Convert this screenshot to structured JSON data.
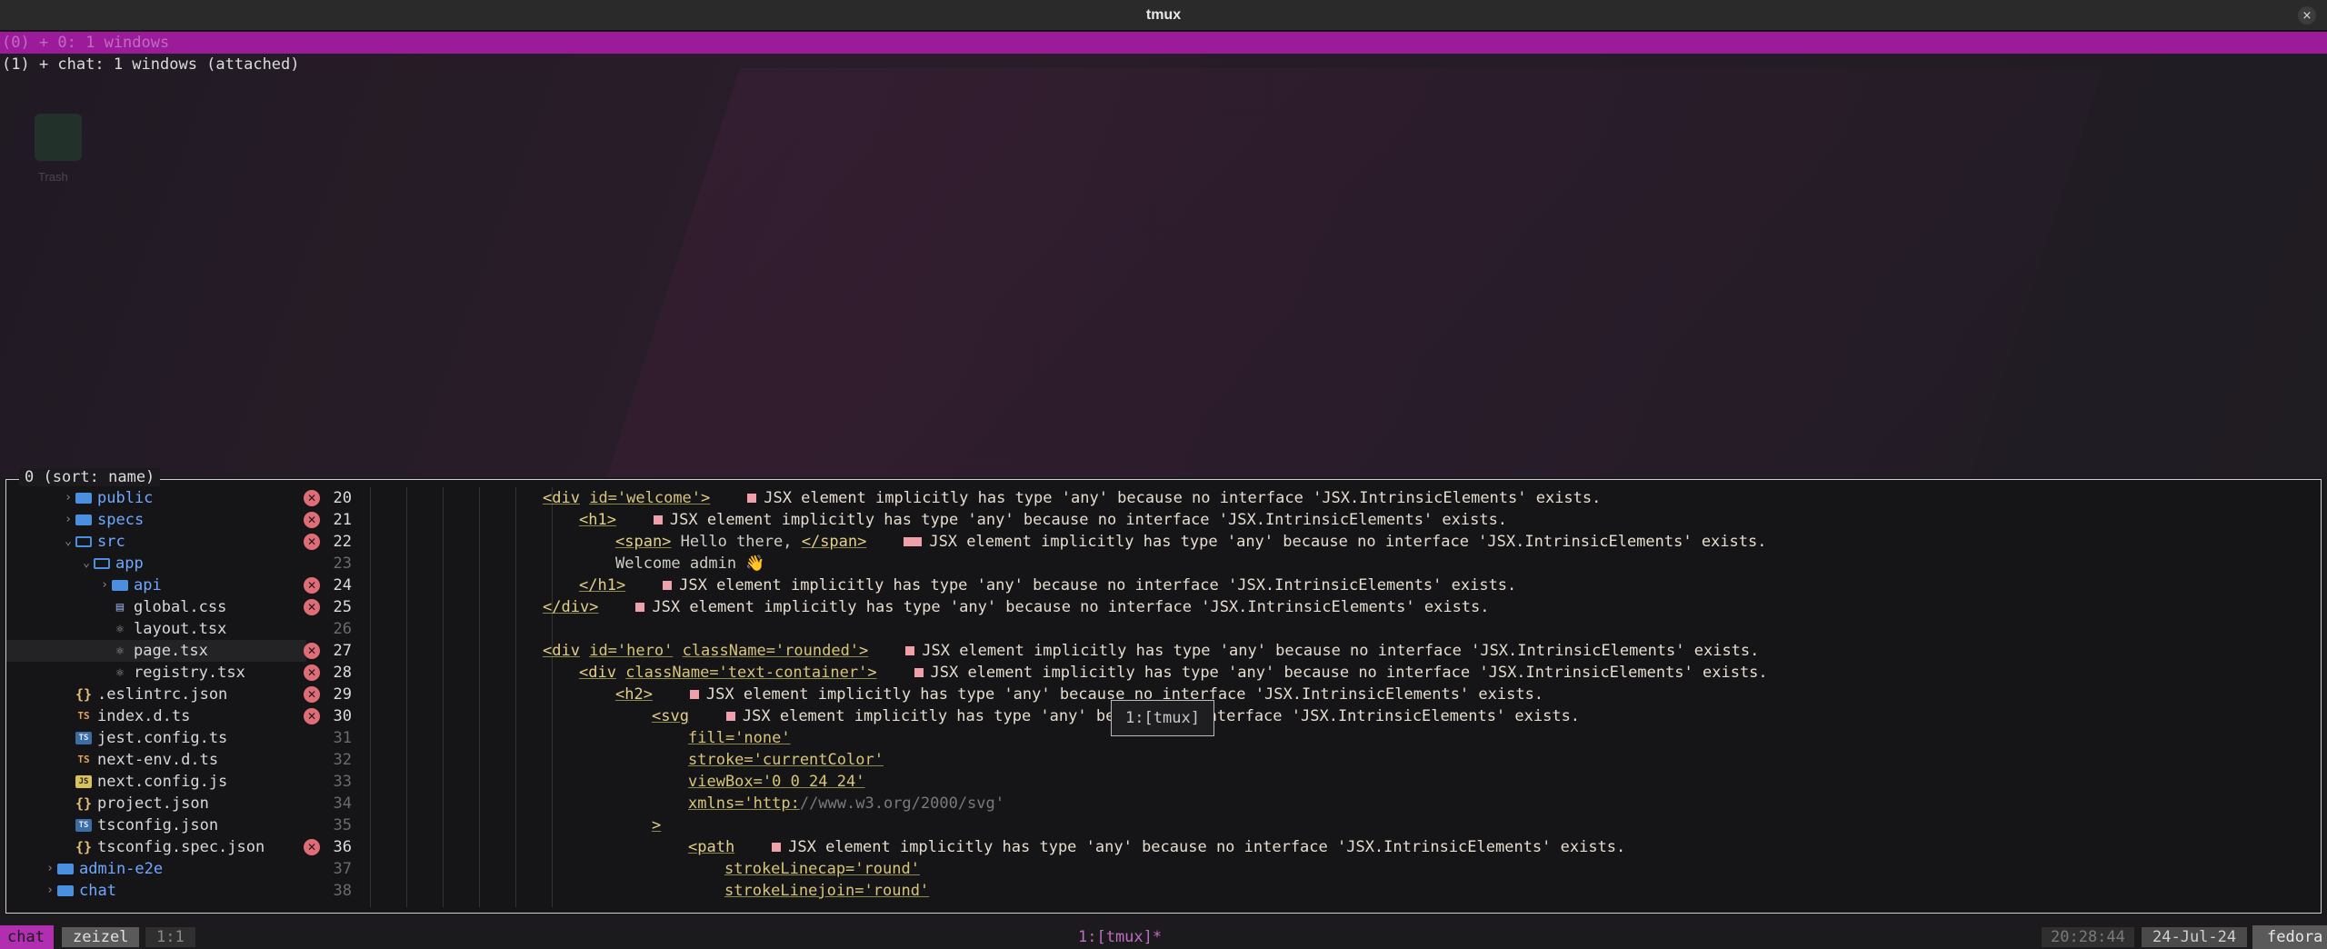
{
  "window": {
    "title": "tmux",
    "close_glyph": "×"
  },
  "tree": {
    "sessions": [
      {
        "text": "(0) + 0: 1 windows",
        "selected": true
      },
      {
        "text": "(1) + chat: 1 windows (attached)",
        "selected": false
      }
    ]
  },
  "desktop": {
    "trash_label": "Trash"
  },
  "preview": {
    "label": "0 (sort: name)",
    "explorer": [
      {
        "name": "public",
        "icon": "folder-icon",
        "depth": 2,
        "chevron": "›",
        "badge": "✕",
        "line": "20"
      },
      {
        "name": "specs",
        "icon": "folder-icon",
        "depth": 2,
        "chevron": "›",
        "badge": "✕",
        "line": "21"
      },
      {
        "name": "src",
        "icon": "folder-open-icon",
        "depth": 2,
        "chevron": "⌄",
        "badge": "✕",
        "line": "22"
      },
      {
        "name": "app",
        "icon": "folder-open-icon",
        "depth": 3,
        "chevron": "⌄",
        "badge": "",
        "line": "23"
      },
      {
        "name": "api",
        "icon": "folder-icon",
        "depth": 4,
        "chevron": "›",
        "badge": "✕",
        "line": "24"
      },
      {
        "name": "global.css",
        "icon": "css-file-icon",
        "depth": 4,
        "chevron": "",
        "badge": "✕",
        "line": "25"
      },
      {
        "name": "layout.tsx",
        "icon": "react-file-icon",
        "depth": 4,
        "chevron": "",
        "badge": "",
        "line": "26"
      },
      {
        "name": "page.tsx",
        "icon": "react-file-icon",
        "depth": 4,
        "chevron": "",
        "badge": "✕",
        "line": "27",
        "selected": true
      },
      {
        "name": "registry.tsx",
        "icon": "react-file-icon",
        "depth": 4,
        "chevron": "",
        "badge": "✕",
        "line": "28"
      },
      {
        "name": ".eslintrc.json",
        "icon": "json-file-icon",
        "depth": 2,
        "chevron": "",
        "badge": "✕",
        "line": "29"
      },
      {
        "name": "index.d.ts",
        "icon": "ts-file-icon",
        "depth": 2,
        "chevron": "",
        "badge": "✕",
        "line": "30"
      },
      {
        "name": "jest.config.ts",
        "icon": "tsconfig-file-icon",
        "depth": 2,
        "chevron": "",
        "badge": "",
        "line": "31"
      },
      {
        "name": "next-env.d.ts",
        "icon": "ts-file-icon",
        "depth": 2,
        "chevron": "",
        "badge": "",
        "line": "32"
      },
      {
        "name": "next.config.js",
        "icon": "js-file-icon",
        "depth": 2,
        "chevron": "",
        "badge": "",
        "line": "33"
      },
      {
        "name": "project.json",
        "icon": "json-file-icon",
        "depth": 2,
        "chevron": "",
        "badge": "",
        "line": "34"
      },
      {
        "name": "tsconfig.json",
        "icon": "tsconfig-file-icon",
        "depth": 2,
        "chevron": "",
        "badge": "",
        "line": "35"
      },
      {
        "name": "tsconfig.spec.json",
        "icon": "json-file-icon",
        "depth": 2,
        "chevron": "",
        "badge": "✕",
        "line": "36"
      },
      {
        "name": "admin-e2e",
        "icon": "folder-icon",
        "depth": 1,
        "chevron": "›",
        "badge": "",
        "line": "37"
      },
      {
        "name": "chat",
        "icon": "folder-icon",
        "depth": 1,
        "chevron": "›",
        "badge": "",
        "line": "38"
      }
    ],
    "diagnostic": "JSX element implicitly has type 'any' because no interface 'JSX.IntrinsicElements' exists.",
    "code": [
      {
        "indent": 0,
        "parts": [
          [
            "tag",
            "<div"
          ],
          [
            "plain",
            " "
          ],
          [
            "attr",
            "id='welcome'"
          ],
          [
            "tag",
            ">"
          ]
        ],
        "diag": true
      },
      {
        "indent": 1,
        "parts": [
          [
            "tag",
            "<h1>"
          ]
        ],
        "diag": true
      },
      {
        "indent": 2,
        "parts": [
          [
            "tag",
            "<span>"
          ],
          [
            "plain",
            " Hello there, "
          ],
          [
            "tag",
            "</span>"
          ]
        ],
        "diag": true,
        "wide": true
      },
      {
        "indent": 2,
        "parts": [
          [
            "plain",
            "Welcome admin 👋"
          ]
        ],
        "diag": false
      },
      {
        "indent": 1,
        "parts": [
          [
            "tag",
            "</h1>"
          ]
        ],
        "diag": true
      },
      {
        "indent": 0,
        "parts": [
          [
            "tag",
            "</div>"
          ]
        ],
        "diag": true
      },
      {
        "indent": 0,
        "parts": [],
        "diag": false
      },
      {
        "indent": 0,
        "parts": [
          [
            "tag",
            "<div"
          ],
          [
            "plain",
            " "
          ],
          [
            "attr",
            "id='hero'"
          ],
          [
            "plain",
            " "
          ],
          [
            "attr",
            "className='rounded'"
          ],
          [
            "tag",
            ">"
          ]
        ],
        "diag": true
      },
      {
        "indent": 1,
        "parts": [
          [
            "tag",
            "<div"
          ],
          [
            "plain",
            " "
          ],
          [
            "attr",
            "className='text-container'"
          ],
          [
            "tag",
            ">"
          ]
        ],
        "diag": true
      },
      {
        "indent": 2,
        "parts": [
          [
            "tag",
            "<h2>"
          ]
        ],
        "diag": true
      },
      {
        "indent": 3,
        "parts": [
          [
            "tag",
            "<svg"
          ]
        ],
        "diag": true
      },
      {
        "indent": 4,
        "parts": [
          [
            "attr",
            "fill='none'"
          ]
        ],
        "diag": false
      },
      {
        "indent": 4,
        "parts": [
          [
            "attr",
            "stroke='currentColor'"
          ]
        ],
        "diag": false
      },
      {
        "indent": 4,
        "parts": [
          [
            "attr",
            "viewBox='0 0 24 24'"
          ]
        ],
        "diag": false
      },
      {
        "indent": 4,
        "parts": [
          [
            "attr",
            "xmlns='http:"
          ],
          [
            "url",
            "//www.w3.org/2000/svg'"
          ]
        ],
        "diag": false
      },
      {
        "indent": 3,
        "parts": [
          [
            "tag",
            ">"
          ]
        ],
        "diag": false
      },
      {
        "indent": 4,
        "parts": [
          [
            "tag",
            "<path"
          ]
        ],
        "diag": true
      },
      {
        "indent": 5,
        "parts": [
          [
            "attr",
            "strokeLinecap='round'"
          ]
        ],
        "diag": false
      },
      {
        "indent": 5,
        "parts": [
          [
            "attr",
            "strokeLinejoin='round'"
          ]
        ],
        "diag": false
      }
    ],
    "popup": "1:[tmux]"
  },
  "status": {
    "session": "chat",
    "host_short": "zeizel",
    "pane": "1:1",
    "window": "1:[tmux]*",
    "time": "20:28:44",
    "date": "24-Jul-24",
    "host": "fedora"
  },
  "colors": {
    "accent": "#b12eb1",
    "error": "#e06c75",
    "folder": "#4b8fe0"
  }
}
